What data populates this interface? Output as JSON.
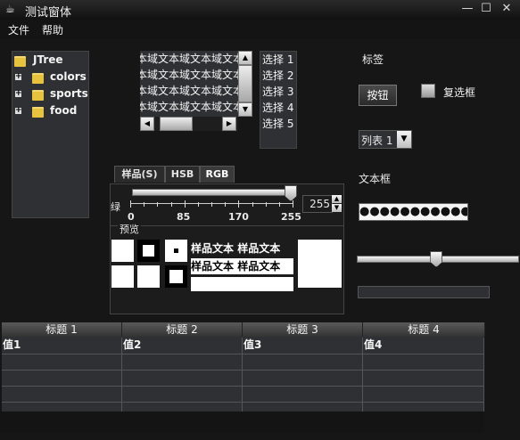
{
  "window": {
    "title": "测试窗体",
    "min_glyph": "—",
    "max_glyph": "☐",
    "close_glyph": "✕"
  },
  "menu": {
    "file": "文件",
    "help": "帮助"
  },
  "tree": {
    "root": "JTree",
    "children": [
      "colors",
      "sports",
      "food"
    ]
  },
  "textarea": {
    "lines": [
      "本域文本域文本域文本域",
      "本域文本域文本域文本域",
      "本域文本域文本域文本域",
      "本域文本域文本域文本域"
    ]
  },
  "list": {
    "items": [
      "选择 1",
      "选择 2",
      "选择 3",
      "选择 4",
      "选择 5"
    ]
  },
  "right": {
    "label": "标签",
    "button": "按钮",
    "checkbox": "复选框",
    "combo_value": "列表 1",
    "textfield_label": "文本框",
    "password": "●●●●●●●●●●●●●●●●",
    "slider_fraction": 0.49,
    "progress_fraction": 0.0
  },
  "color_chooser": {
    "tabs": [
      "样品(S)",
      "HSB",
      "RGB"
    ],
    "selected_tab": "RGB",
    "channel_label": "绿",
    "slider_value": "255",
    "ticks": [
      "0",
      "85",
      "170",
      "255"
    ],
    "preview_title": "预览",
    "sample_text": [
      "样品文本",
      "样品文本",
      "样品文本",
      "样品文本"
    ]
  },
  "table": {
    "headers": [
      "标题 1",
      "标题 2",
      "标题 3",
      "标题 4"
    ],
    "rows": [
      [
        "值1",
        "值2",
        "值3",
        "值4"
      ],
      [
        "",
        "",
        "",
        ""
      ],
      [
        "",
        "",
        "",
        ""
      ],
      [
        "",
        "",
        "",
        ""
      ],
      [
        "",
        "",
        "",
        ""
      ]
    ]
  }
}
